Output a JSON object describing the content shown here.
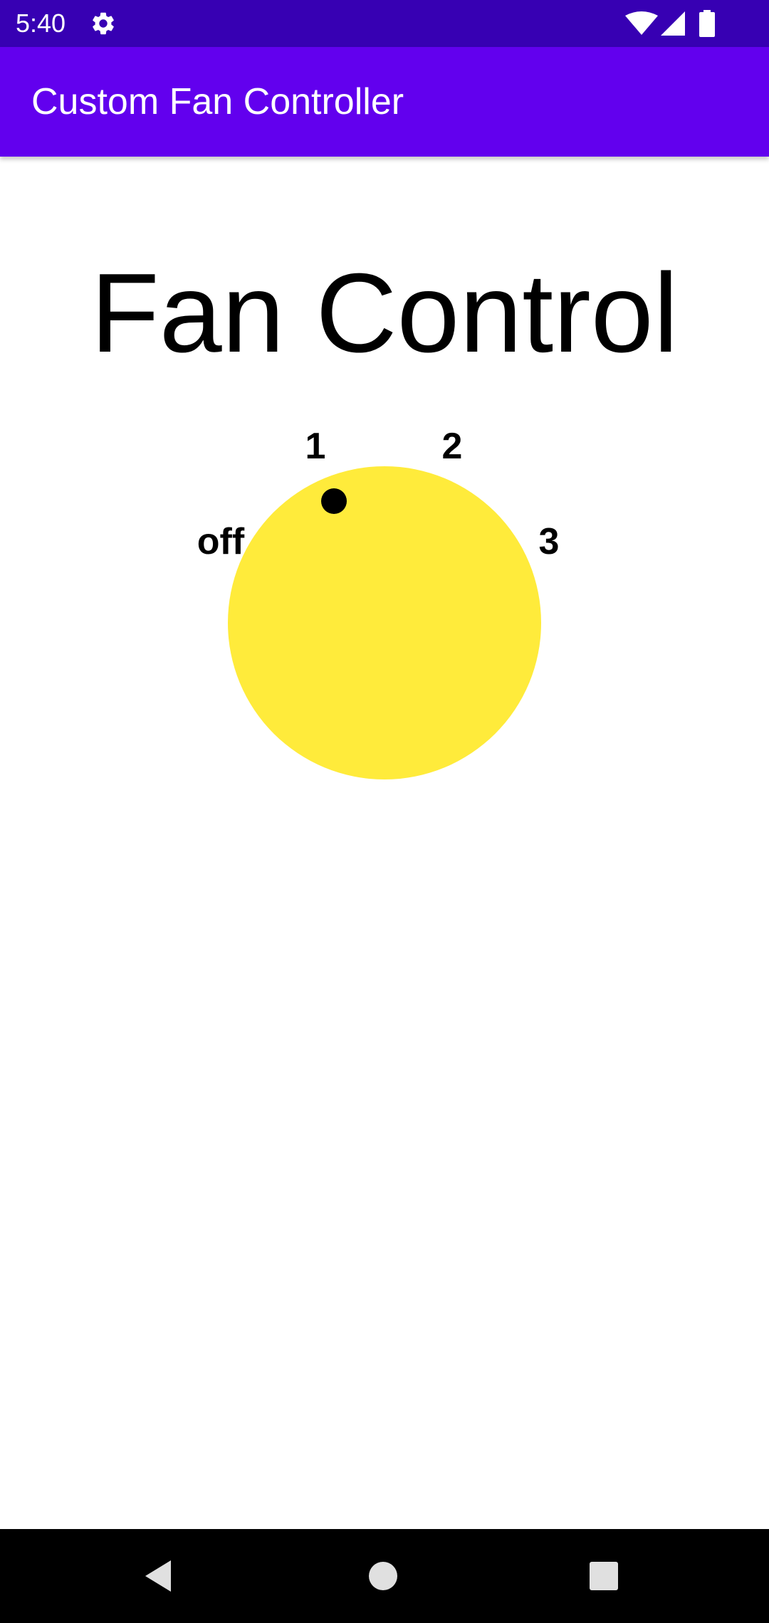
{
  "status_bar": {
    "time": "5:40",
    "icons": [
      "settings-icon",
      "wifi-icon",
      "signal-icon",
      "battery-icon"
    ]
  },
  "app_bar": {
    "title": "Custom Fan Controller"
  },
  "main": {
    "heading": "Fan Control"
  },
  "fan_dial": {
    "labels": [
      "off",
      "1",
      "2",
      "3"
    ],
    "selected": "1",
    "colors": {
      "dial": "#FFEB3B",
      "indicator": "#000000",
      "labels": "#000000"
    }
  },
  "nav_bar": {
    "buttons": [
      "back-icon",
      "home-icon",
      "recents-icon"
    ]
  },
  "colors": {
    "status_bar": "#3700B3",
    "app_bar": "#6200EE",
    "background": "#FFFFFF",
    "nav_bar": "#000000"
  }
}
